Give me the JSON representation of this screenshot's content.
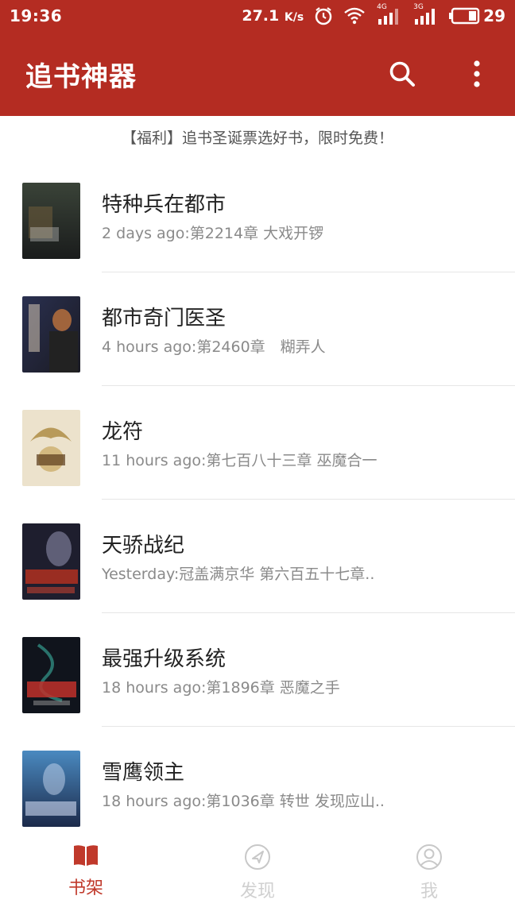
{
  "status_bar": {
    "time": "19:36",
    "speed": "27.1",
    "speed_unit": "K/s",
    "net_4g": "4G",
    "net_3g": "3G",
    "battery": "29"
  },
  "app_bar": {
    "title": "追书神器",
    "color": "#b42c22"
  },
  "promo_text": "【福利】追书圣诞票选好书，限时免费！",
  "books": [
    {
      "title": "特种兵在都市",
      "latest": "2 days ago:第2214章 大戏开锣",
      "cover_colors": [
        "#2b3330",
        "#6b5a3a"
      ]
    },
    {
      "title": "都市奇门医圣",
      "latest": "4 hours ago:第2460章　糊弄人",
      "cover_colors": [
        "#2a2a3a",
        "#a0643c"
      ]
    },
    {
      "title": "龙符",
      "latest": "11 hours ago:第七百八十三章  巫魔合一",
      "cover_colors": [
        "#e8dcc0",
        "#b89a5a"
      ]
    },
    {
      "title": "天骄战纪",
      "latest": "Yesterday:冠盖满京华 第六百五十七章..",
      "cover_colors": [
        "#1e1e2e",
        "#b03020"
      ]
    },
    {
      "title": "最强升级系统",
      "latest": "18 hours ago:第1896章 恶魔之手",
      "cover_colors": [
        "#10141c",
        "#c0302a"
      ]
    },
    {
      "title": "雪鹰领主",
      "latest": "18 hours ago:第1036章 转世 发现应山..",
      "cover_colors": [
        "#1c3a6a",
        "#4a8ac0"
      ]
    }
  ],
  "bottom_nav": {
    "tabs": [
      {
        "label": "书架",
        "icon": "book-icon",
        "active": true
      },
      {
        "label": "发现",
        "icon": "compass-icon",
        "active": false
      },
      {
        "label": "我",
        "icon": "user-icon",
        "active": false
      }
    ],
    "active_color": "#c0392b",
    "inactive_color": "#d0d0d0"
  }
}
